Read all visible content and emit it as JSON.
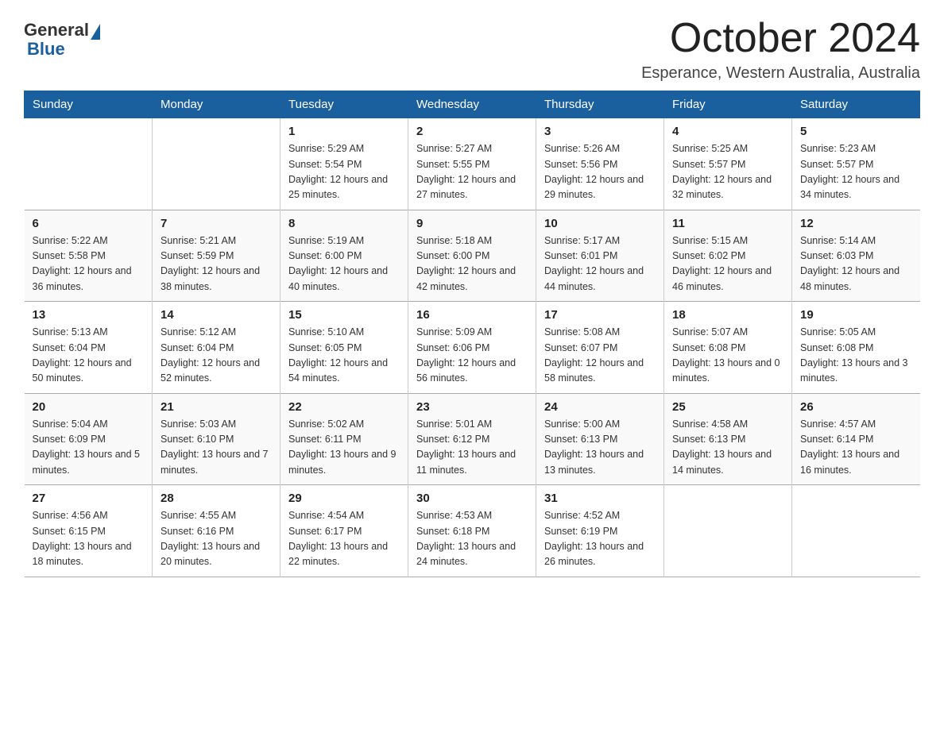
{
  "logo": {
    "general": "General",
    "blue": "Blue"
  },
  "title": "October 2024",
  "location": "Esperance, Western Australia, Australia",
  "headers": [
    "Sunday",
    "Monday",
    "Tuesday",
    "Wednesday",
    "Thursday",
    "Friday",
    "Saturday"
  ],
  "weeks": [
    [
      {
        "day": "",
        "info": ""
      },
      {
        "day": "",
        "info": ""
      },
      {
        "day": "1",
        "info": "Sunrise: 5:29 AM\nSunset: 5:54 PM\nDaylight: 12 hours\nand 25 minutes."
      },
      {
        "day": "2",
        "info": "Sunrise: 5:27 AM\nSunset: 5:55 PM\nDaylight: 12 hours\nand 27 minutes."
      },
      {
        "day": "3",
        "info": "Sunrise: 5:26 AM\nSunset: 5:56 PM\nDaylight: 12 hours\nand 29 minutes."
      },
      {
        "day": "4",
        "info": "Sunrise: 5:25 AM\nSunset: 5:57 PM\nDaylight: 12 hours\nand 32 minutes."
      },
      {
        "day": "5",
        "info": "Sunrise: 5:23 AM\nSunset: 5:57 PM\nDaylight: 12 hours\nand 34 minutes."
      }
    ],
    [
      {
        "day": "6",
        "info": "Sunrise: 5:22 AM\nSunset: 5:58 PM\nDaylight: 12 hours\nand 36 minutes."
      },
      {
        "day": "7",
        "info": "Sunrise: 5:21 AM\nSunset: 5:59 PM\nDaylight: 12 hours\nand 38 minutes."
      },
      {
        "day": "8",
        "info": "Sunrise: 5:19 AM\nSunset: 6:00 PM\nDaylight: 12 hours\nand 40 minutes."
      },
      {
        "day": "9",
        "info": "Sunrise: 5:18 AM\nSunset: 6:00 PM\nDaylight: 12 hours\nand 42 minutes."
      },
      {
        "day": "10",
        "info": "Sunrise: 5:17 AM\nSunset: 6:01 PM\nDaylight: 12 hours\nand 44 minutes."
      },
      {
        "day": "11",
        "info": "Sunrise: 5:15 AM\nSunset: 6:02 PM\nDaylight: 12 hours\nand 46 minutes."
      },
      {
        "day": "12",
        "info": "Sunrise: 5:14 AM\nSunset: 6:03 PM\nDaylight: 12 hours\nand 48 minutes."
      }
    ],
    [
      {
        "day": "13",
        "info": "Sunrise: 5:13 AM\nSunset: 6:04 PM\nDaylight: 12 hours\nand 50 minutes."
      },
      {
        "day": "14",
        "info": "Sunrise: 5:12 AM\nSunset: 6:04 PM\nDaylight: 12 hours\nand 52 minutes."
      },
      {
        "day": "15",
        "info": "Sunrise: 5:10 AM\nSunset: 6:05 PM\nDaylight: 12 hours\nand 54 minutes."
      },
      {
        "day": "16",
        "info": "Sunrise: 5:09 AM\nSunset: 6:06 PM\nDaylight: 12 hours\nand 56 minutes."
      },
      {
        "day": "17",
        "info": "Sunrise: 5:08 AM\nSunset: 6:07 PM\nDaylight: 12 hours\nand 58 minutes."
      },
      {
        "day": "18",
        "info": "Sunrise: 5:07 AM\nSunset: 6:08 PM\nDaylight: 13 hours\nand 0 minutes."
      },
      {
        "day": "19",
        "info": "Sunrise: 5:05 AM\nSunset: 6:08 PM\nDaylight: 13 hours\nand 3 minutes."
      }
    ],
    [
      {
        "day": "20",
        "info": "Sunrise: 5:04 AM\nSunset: 6:09 PM\nDaylight: 13 hours\nand 5 minutes."
      },
      {
        "day": "21",
        "info": "Sunrise: 5:03 AM\nSunset: 6:10 PM\nDaylight: 13 hours\nand 7 minutes."
      },
      {
        "day": "22",
        "info": "Sunrise: 5:02 AM\nSunset: 6:11 PM\nDaylight: 13 hours\nand 9 minutes."
      },
      {
        "day": "23",
        "info": "Sunrise: 5:01 AM\nSunset: 6:12 PM\nDaylight: 13 hours\nand 11 minutes."
      },
      {
        "day": "24",
        "info": "Sunrise: 5:00 AM\nSunset: 6:13 PM\nDaylight: 13 hours\nand 13 minutes."
      },
      {
        "day": "25",
        "info": "Sunrise: 4:58 AM\nSunset: 6:13 PM\nDaylight: 13 hours\nand 14 minutes."
      },
      {
        "day": "26",
        "info": "Sunrise: 4:57 AM\nSunset: 6:14 PM\nDaylight: 13 hours\nand 16 minutes."
      }
    ],
    [
      {
        "day": "27",
        "info": "Sunrise: 4:56 AM\nSunset: 6:15 PM\nDaylight: 13 hours\nand 18 minutes."
      },
      {
        "day": "28",
        "info": "Sunrise: 4:55 AM\nSunset: 6:16 PM\nDaylight: 13 hours\nand 20 minutes."
      },
      {
        "day": "29",
        "info": "Sunrise: 4:54 AM\nSunset: 6:17 PM\nDaylight: 13 hours\nand 22 minutes."
      },
      {
        "day": "30",
        "info": "Sunrise: 4:53 AM\nSunset: 6:18 PM\nDaylight: 13 hours\nand 24 minutes."
      },
      {
        "day": "31",
        "info": "Sunrise: 4:52 AM\nSunset: 6:19 PM\nDaylight: 13 hours\nand 26 minutes."
      },
      {
        "day": "",
        "info": ""
      },
      {
        "day": "",
        "info": ""
      }
    ]
  ]
}
